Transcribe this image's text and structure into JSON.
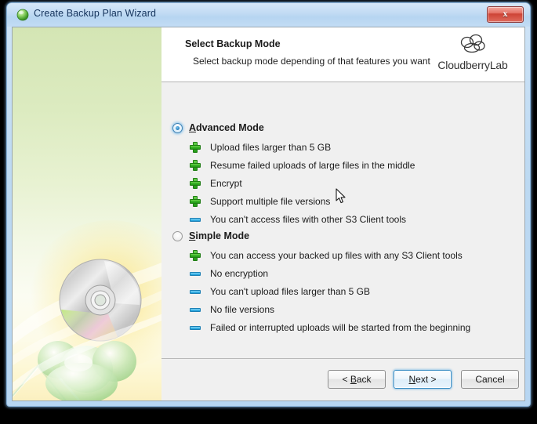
{
  "window": {
    "title": "Create Backup Plan Wizard",
    "title_icon": "green-sphere-icon",
    "close_label": "x"
  },
  "header": {
    "title": "Select Backup Mode",
    "subtitle": "Select backup mode depending of that features you want",
    "brand_name": "CloudberryLab",
    "brand_icon": "cloud-icon"
  },
  "modes": [
    {
      "id": "advanced",
      "label_prefix": "",
      "accel": "A",
      "label_rest": "dvanced Mode",
      "label_full": "Advanced Mode",
      "selected": true,
      "features": [
        {
          "type": "plus",
          "text": "Upload files larger than 5 GB"
        },
        {
          "type": "plus",
          "text": "Resume failed uploads of large files in the middle"
        },
        {
          "type": "plus",
          "text": "Encrypt"
        },
        {
          "type": "plus",
          "text": "Support multiple file versions"
        },
        {
          "type": "minus",
          "text": "You can't access files with other S3 Client tools"
        }
      ]
    },
    {
      "id": "simple",
      "label_prefix": "",
      "accel": "S",
      "label_rest": "imple Mode",
      "label_full": "Simple Mode",
      "selected": false,
      "features": [
        {
          "type": "plus",
          "text": "You can access your backed up files with any S3 Client tools"
        },
        {
          "type": "minus",
          "text": "No encryption"
        },
        {
          "type": "minus",
          "text": "You can't upload files larger than 5 GB"
        },
        {
          "type": "minus",
          "text": "No file versions"
        },
        {
          "type": "minus",
          "text": "Failed or interrupted uploads will be started from the beginning"
        }
      ]
    }
  ],
  "footer": {
    "back_prefix": "< ",
    "back_accel": "B",
    "back_rest": "ack",
    "back_label": "< Back",
    "next_accel": "N",
    "next_rest": "ext >",
    "next_label": "Next >",
    "cancel_label": "Cancel"
  },
  "colors": {
    "titlebar": "#bcd9f2",
    "close_button": "#cc4335",
    "panel_background": "#f0f0f0",
    "header_background": "#ffffff",
    "plus_icon": "#31ad21",
    "minus_icon": "#3ab4e8",
    "radio_selected": "#2a84c4",
    "default_button_border": "#3c8ec4",
    "sidebar_gradient_top": "#d4e5b4",
    "sidebar_gradient_bottom": "#fbf0c0"
  }
}
